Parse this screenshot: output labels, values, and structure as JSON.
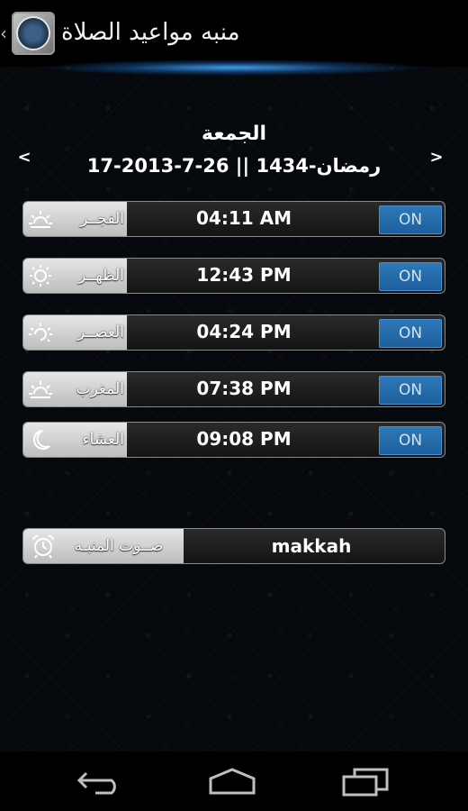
{
  "app": {
    "title": "منبه مواعيد الصلاة",
    "back_glyph": "‹",
    "icon": "quran-app-icon"
  },
  "date_header": {
    "day_name": "الجمعة",
    "date_line": "17-رمضان-1434 || 26-7-2013",
    "prev_arrow": "<",
    "next_arrow": ">"
  },
  "prayers": [
    {
      "name": "الفجــر",
      "time": "04:11 AM",
      "toggle": "ON",
      "icon": "sunrise-icon"
    },
    {
      "name": "الظهــر",
      "time": "12:43 PM",
      "toggle": "ON",
      "icon": "sun-icon"
    },
    {
      "name": "العصــر",
      "time": "04:24 PM",
      "toggle": "ON",
      "icon": "sun-half-icon"
    },
    {
      "name": "المغرب",
      "time": "07:38 PM",
      "toggle": "ON",
      "icon": "sunset-icon"
    },
    {
      "name": "العشاء",
      "time": "09:08 PM",
      "toggle": "ON",
      "icon": "crescent-moon-icon"
    }
  ],
  "alarm_sound": {
    "label": "صــوت المنبـه",
    "value": "makkah",
    "icon": "alarm-clock-icon"
  },
  "navbar": {
    "back": "back-icon",
    "home": "home-icon",
    "recent": "recent-apps-icon"
  },
  "colors": {
    "accent_blue": "#2f78b8",
    "label_gray": "#d0d0d0",
    "background": "#05080c"
  }
}
